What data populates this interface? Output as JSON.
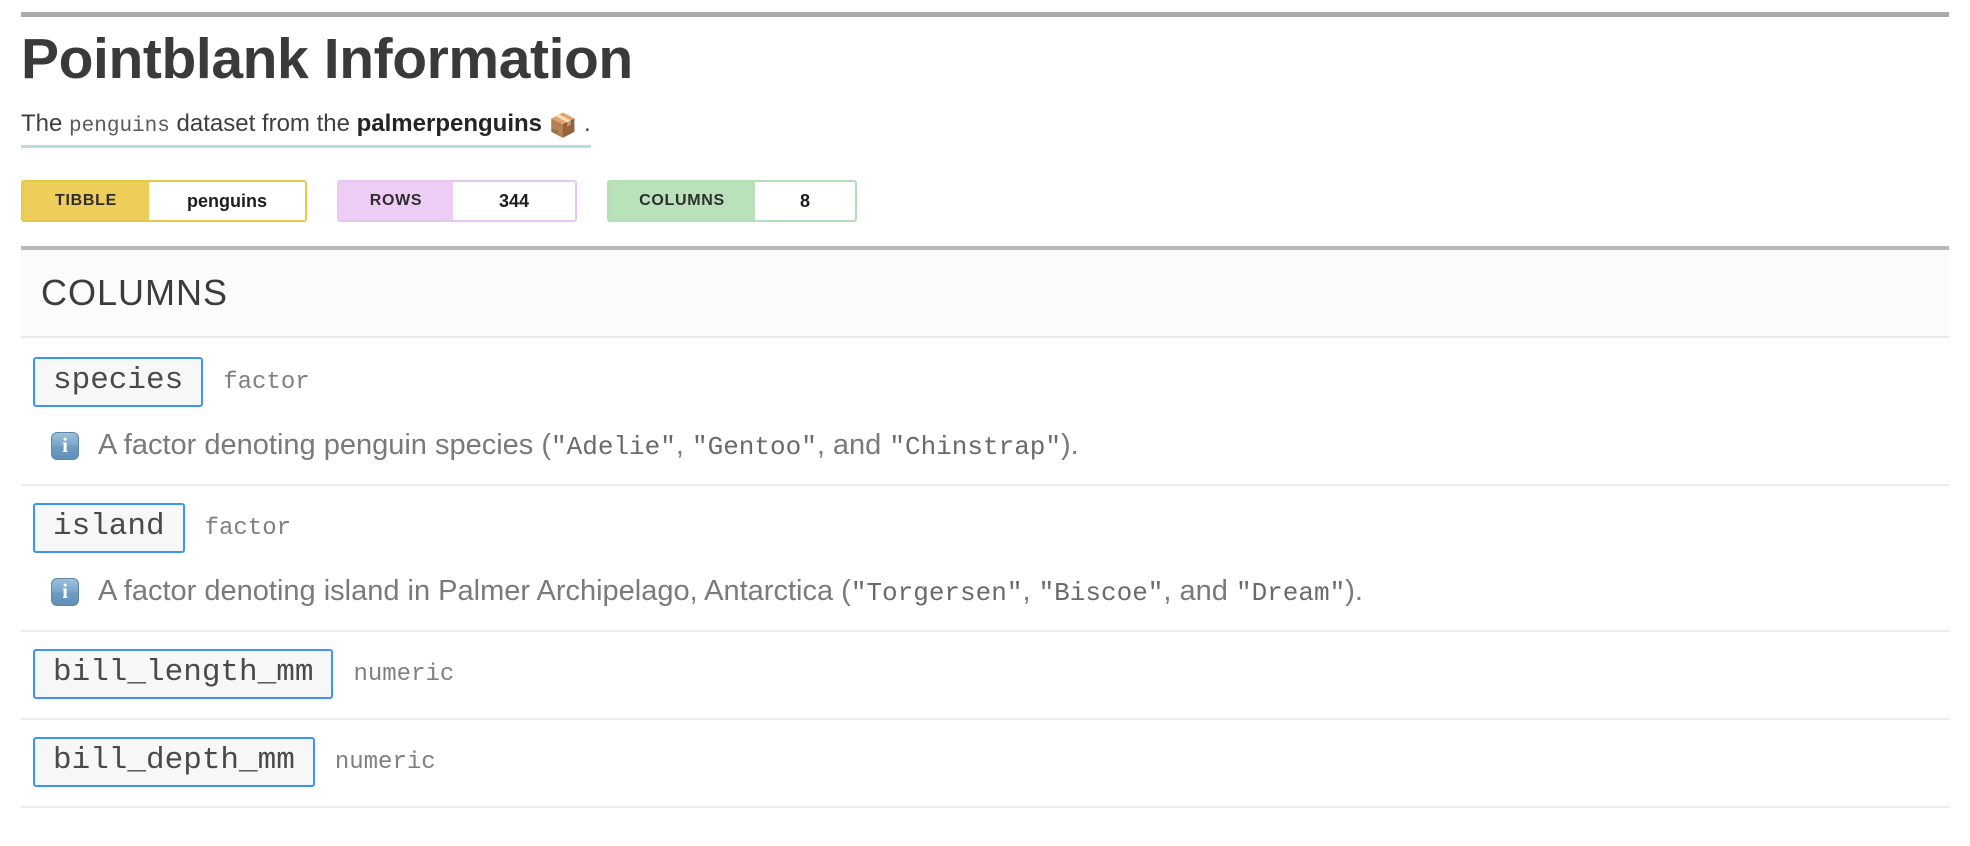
{
  "header": {
    "title": "Pointblank Information",
    "subtitle_pre": "The ",
    "subtitle_table": "penguins",
    "subtitle_mid": " dataset from the ",
    "subtitle_package": "palmerpenguins",
    "subtitle_emoji": "📦",
    "subtitle_post": "."
  },
  "badges": [
    {
      "label": "TIBBLE",
      "value": "penguins",
      "label_color": "#edce5a",
      "border_color": "#e8c84a"
    },
    {
      "label": "ROWS",
      "value": "344",
      "label_color": "#edcdf4",
      "border_color": "#e7c7f0"
    },
    {
      "label": "COLUMNS",
      "value": "8",
      "label_color": "#b9e2bb",
      "border_color": "#b4dfb6"
    }
  ],
  "section": {
    "title": "COLUMNS"
  },
  "columns": [
    {
      "name": "species",
      "type": "factor",
      "desc_parts": [
        {
          "text": "A factor denoting penguin species (",
          "mono": false
        },
        {
          "text": "\"Adelie\"",
          "mono": true
        },
        {
          "text": ", ",
          "mono": false
        },
        {
          "text": "\"Gentoo\"",
          "mono": true
        },
        {
          "text": ", and ",
          "mono": false
        },
        {
          "text": "\"Chinstrap\"",
          "mono": true
        },
        {
          "text": ").",
          "mono": false
        }
      ]
    },
    {
      "name": "island",
      "type": "factor",
      "desc_parts": [
        {
          "text": "A factor denoting island in Palmer Archipelago, Antarctica (",
          "mono": false
        },
        {
          "text": "\"Torgersen\"",
          "mono": true
        },
        {
          "text": ", ",
          "mono": false
        },
        {
          "text": "\"Biscoe\"",
          "mono": true
        },
        {
          "text": ", and ",
          "mono": false
        },
        {
          "text": "\"Dream\"",
          "mono": true
        },
        {
          "text": ").",
          "mono": false
        }
      ]
    },
    {
      "name": "bill_length_mm",
      "type": "numeric",
      "desc_parts": []
    },
    {
      "name": "bill_depth_mm",
      "type": "numeric",
      "desc_parts": []
    }
  ],
  "colors": {
    "accent_blue": "#3d95f2",
    "rule_gray": "#ababab",
    "section_bg": "#fbfbfb",
    "underline_cyan": "#b5dde3"
  }
}
